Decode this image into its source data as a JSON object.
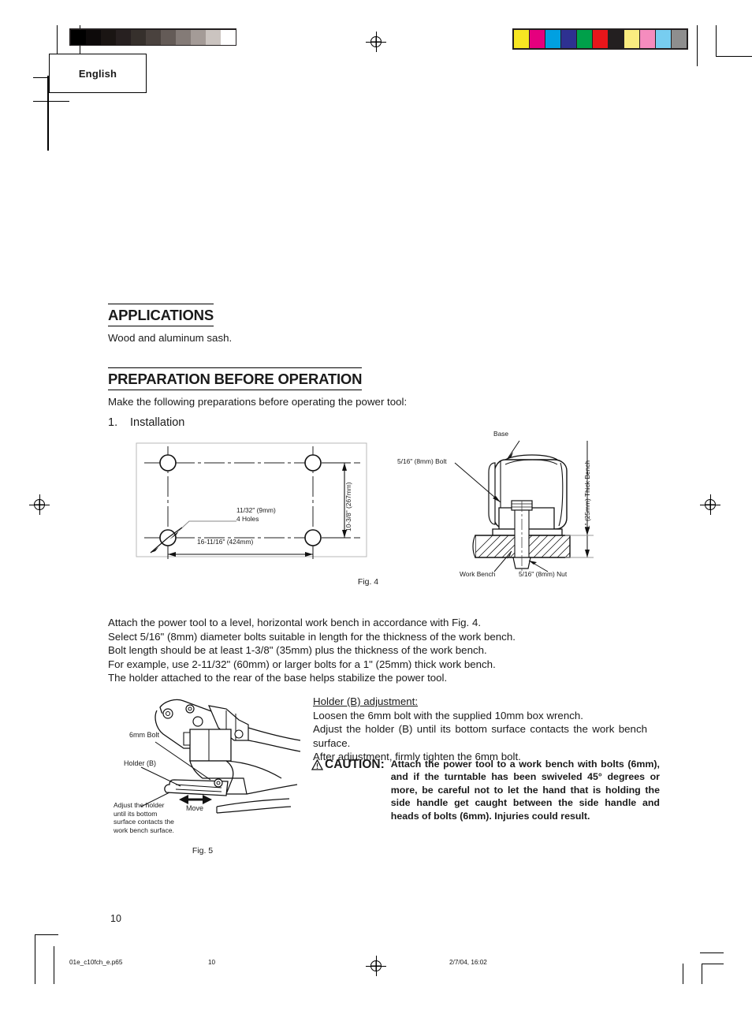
{
  "marks": {
    "language_label": "English",
    "grayscale_swatches": [
      "#000000",
      "#0d0a0a",
      "#1a1513",
      "#272020",
      "#36302c",
      "#4a423e",
      "#645b57",
      "#847b77",
      "#a49b97",
      "#cbc4c0",
      "#ffffff"
    ],
    "color_swatches": [
      "#f7e622",
      "#e5007e",
      "#00a0e1",
      "#2e3191",
      "#00a04a",
      "#e8161b",
      "#231f20",
      "#faec80",
      "#f58cbe",
      "#77cdf0",
      "#8e8e8e"
    ]
  },
  "sections": {
    "applications": {
      "heading": "APPLICATIONS",
      "body": "Wood and aluminum sash."
    },
    "preparation": {
      "heading": "PREPARATION BEFORE OPERATION",
      "intro": "Make the following preparations before operating the power tool:",
      "item_number": "1.",
      "item_title": "Installation"
    }
  },
  "fig4": {
    "caption": "Fig. 4",
    "labels": {
      "holes": "11/32\" (9mm)",
      "holes2": "4 Holes",
      "width": "16-11/16\" (424mm)",
      "height": "10-3/8\" (267mm)"
    }
  },
  "fig_bench": {
    "labels": {
      "base": "Base",
      "bolt": "5/16\" (8mm) Bolt",
      "thickness": "1\" (25mm) Thick Bench",
      "work_bench": "Work Bench",
      "nut": "5/16\" (8mm) Nut"
    }
  },
  "install_paragraph": [
    "Attach the power tool to a level, horizontal work bench in accordance with Fig. 4.",
    "Select 5/16\" (8mm) diameter bolts suitable in length for the thickness of the work bench.",
    "Bolt length should be at least 1-3/8\" (35mm) plus the thickness of the work bench.",
    "For example, use 2-11/32\" (60mm) or larger bolts for a 1\" (25mm) thick work bench.",
    "The holder attached to the rear of the base helps stabilize the power tool."
  ],
  "holder_adjustment": {
    "title": "Holder (B) adjustment:",
    "line1": "Loosen the 6mm bolt with the supplied 10mm box wrench.",
    "line2": "Adjust the holder (B) until its bottom surface contacts the work bench surface.",
    "line3": "After adjustment, firmly tighten the 6mm bolt."
  },
  "caution": {
    "word": "CAUTION:",
    "text": "Attach the power tool to a work bench with bolts (6mm), and if the turntable has been swiveled 45° degrees or more, be careful not to let the hand that is holding the side handle get caught between the side handle and heads of bolts (6mm).  Injuries could result."
  },
  "fig5": {
    "caption": "Fig. 5",
    "labels": {
      "bolt": "6mm Bolt",
      "holder": "Holder (B)",
      "move": "Move",
      "note1": "Adjust the holder",
      "note2": "until its bottom",
      "note3": "surface contacts the",
      "note4": "work bench surface."
    }
  },
  "footer": {
    "page_number": "10",
    "file_name": "01e_c10fch_e.p65",
    "footer_page": "10",
    "timestamp": "2/7/04, 16:02"
  }
}
